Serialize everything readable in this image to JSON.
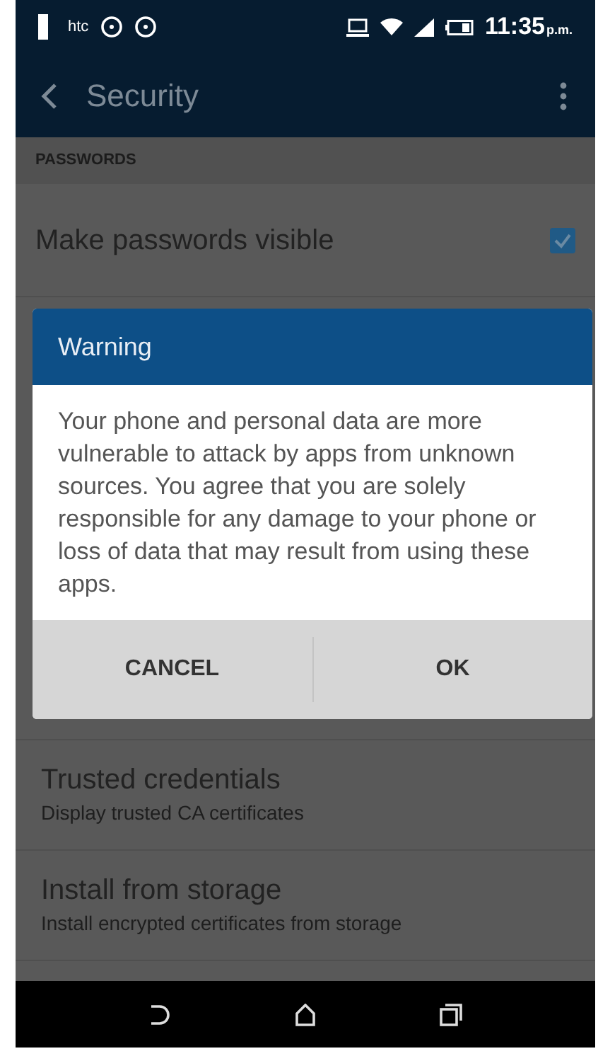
{
  "status_bar": {
    "carrier": "htc",
    "time": "11:35",
    "period": "p.m."
  },
  "app_bar": {
    "title": "Security"
  },
  "sections": [
    {
      "header": "PASSWORDS",
      "items": [
        {
          "kind": "checkbox",
          "title": "Make passwords visible",
          "checked": true
        }
      ]
    }
  ],
  "dialog": {
    "title": "Warning",
    "message": "Your phone and personal data are more vulnerable to attack by apps from unknown sources. You agree that you are solely responsible for any damage to your phone or loss of data that may result from using these apps.",
    "buttons": [
      "CANCEL",
      "OK"
    ]
  },
  "list_below": [
    {
      "title": "Trusted credentials",
      "subtitle": "Display trusted CA certificates"
    },
    {
      "title": "Install from storage",
      "subtitle": "Install encrypted certificates from storage"
    }
  ]
}
